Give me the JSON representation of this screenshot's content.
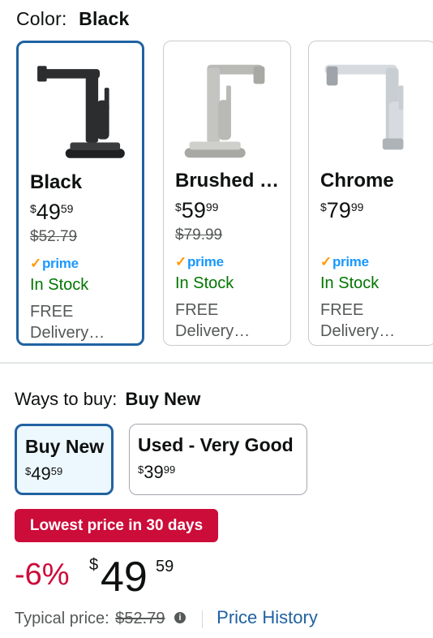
{
  "color_selector": {
    "label": "Color:",
    "selected": "Black"
  },
  "swatches": [
    {
      "name": "Black",
      "price_symbol": "$",
      "price_whole": "49",
      "price_fraction": "59",
      "list_price": "$52.79",
      "prime": "prime",
      "stock": "In Stock",
      "delivery_line1": "FREE",
      "delivery_line2": "Delivery…",
      "finish": "#2b2d2f",
      "selected": true
    },
    {
      "name": "Brushed …",
      "price_symbol": "$",
      "price_whole": "59",
      "price_fraction": "99",
      "list_price": "$79.99",
      "prime": "prime",
      "stock": "In Stock",
      "delivery_line1": "FREE",
      "delivery_line2": "Delivery…",
      "finish": "#b9b9b5",
      "selected": false
    },
    {
      "name": "Chrome",
      "price_symbol": "$",
      "price_whole": "79",
      "price_fraction": "99",
      "list_price": "",
      "prime": "prime",
      "stock": "In Stock",
      "delivery_line1": "FREE",
      "delivery_line2": "Delivery…",
      "finish": "#d7dbdf",
      "selected": false
    }
  ],
  "ways_to_buy": {
    "label": "Ways to buy:",
    "selected": "Buy New",
    "options": [
      {
        "title": "Buy New",
        "price_symbol": "$",
        "price_whole": "49",
        "price_fraction": "59",
        "selected": true
      },
      {
        "title": "Used - Very Good",
        "price_symbol": "$",
        "price_whole": "39",
        "price_fraction": "99",
        "selected": false
      }
    ]
  },
  "deal_badge": "Lowest price in 30 days",
  "price": {
    "discount": "-6%",
    "currency": "$",
    "whole": "49",
    "fraction": "59"
  },
  "typical_price": {
    "label": "Typical price:",
    "value": "$52.79",
    "info_icon": "info-icon",
    "history_link": "Price History"
  },
  "colors": {
    "accent_blue": "#2162a1",
    "deal_red": "#cc0c39",
    "in_stock_green": "#007600",
    "prime_blue": "#1a98ff",
    "prime_check": "#ff9900"
  }
}
